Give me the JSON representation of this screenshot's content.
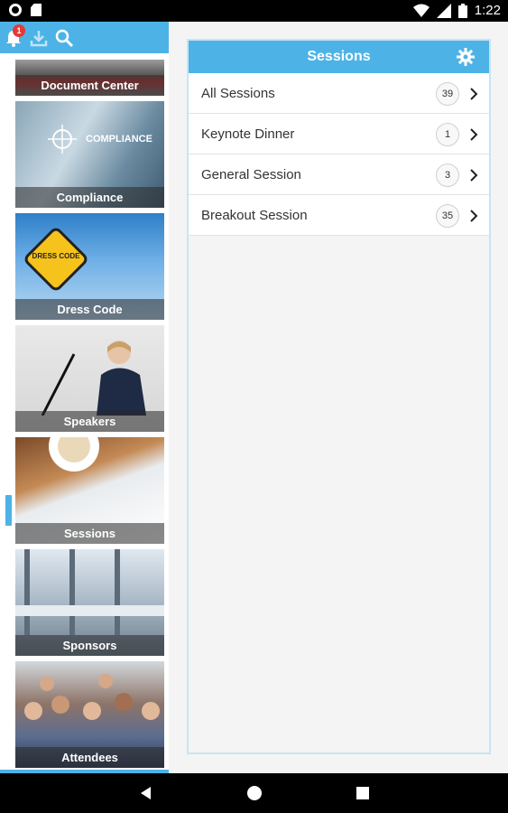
{
  "status_bar": {
    "time": "1:22"
  },
  "toolbar": {
    "notification_count": "1",
    "icons": [
      "bell-icon",
      "download-icon",
      "search-icon"
    ]
  },
  "sidebar": {
    "tiles": [
      {
        "label": "Document Center"
      },
      {
        "label": "Compliance",
        "image_text": "COMPLIANCE"
      },
      {
        "label": "Dress Code",
        "image_text": "DRESS CODE"
      },
      {
        "label": "Speakers"
      },
      {
        "label": "Sessions"
      },
      {
        "label": "Sponsors"
      },
      {
        "label": "Attendees"
      }
    ]
  },
  "sessions": {
    "title": "Sessions",
    "items": [
      {
        "label": "All Sessions",
        "count": "39"
      },
      {
        "label": "Keynote Dinner",
        "count": "1"
      },
      {
        "label": "General Session",
        "count": "3"
      },
      {
        "label": "Breakout Session",
        "count": "35"
      }
    ]
  },
  "colors": {
    "accent": "#4db3e6",
    "badge": "#e53935"
  }
}
